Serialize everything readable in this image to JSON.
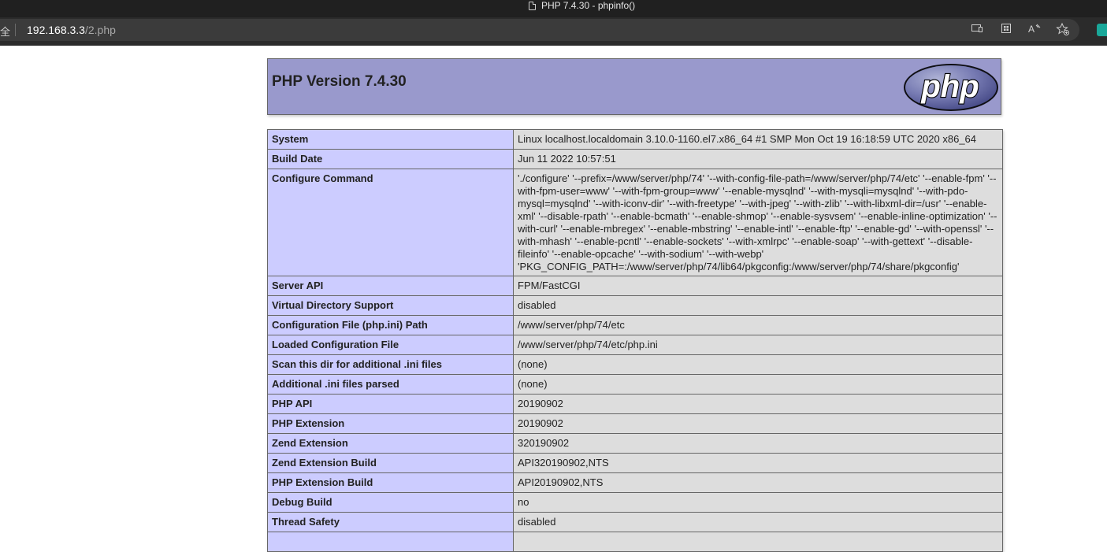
{
  "window": {
    "title": "PHP 7.4.30 - phpinfo()"
  },
  "addressbar": {
    "lock_fragment": "全",
    "url_host": "192.168.3.3",
    "url_path": "/2.php",
    "icons": [
      "immersive-reader-icon",
      "app-available-icon",
      "read-aloud-icon",
      "add-favorite-icon",
      "extension-icon"
    ]
  },
  "page": {
    "heading": "PHP Version 7.4.30",
    "logo_text": "php",
    "colors": {
      "header_bg": "#9999cc",
      "key_cell_bg": "#ccccff",
      "value_cell_bg": "#dddddd"
    },
    "rows": [
      {
        "key": "System",
        "value": "Linux localhost.localdomain 3.10.0-1160.el7.x86_64 #1 SMP Mon Oct 19 16:18:59 UTC 2020 x86_64"
      },
      {
        "key": "Build Date",
        "value": "Jun 11 2022 10:57:51"
      },
      {
        "key": "Configure Command",
        "value": "'./configure' '--prefix=/www/server/php/74' '--with-config-file-path=/www/server/php/74/etc' '--enable-fpm' '--with-fpm-user=www' '--with-fpm-group=www' '--enable-mysqlnd' '--with-mysqli=mysqlnd' '--with-pdo-mysql=mysqlnd' '--with-iconv-dir' '--with-freetype' '--with-jpeg' '--with-zlib' '--with-libxml-dir=/usr' '--enable-xml' '--disable-rpath' '--enable-bcmath' '--enable-shmop' '--enable-sysvsem' '--enable-inline-optimization' '--with-curl' '--enable-mbregex' '--enable-mbstring' '--enable-intl' '--enable-ftp' '--enable-gd' '--with-openssl' '--with-mhash' '--enable-pcntl' '--enable-sockets' '--with-xmlrpc' '--enable-soap' '--with-gettext' '--disable-fileinfo' '--enable-opcache' '--with-sodium' '--with-webp' 'PKG_CONFIG_PATH=:/www/server/php/74/lib64/pkgconfig:/www/server/php/74/share/pkgconfig'"
      },
      {
        "key": "Server API",
        "value": "FPM/FastCGI"
      },
      {
        "key": "Virtual Directory Support",
        "value": "disabled"
      },
      {
        "key": "Configuration File (php.ini) Path",
        "value": "/www/server/php/74/etc"
      },
      {
        "key": "Loaded Configuration File",
        "value": "/www/server/php/74/etc/php.ini"
      },
      {
        "key": "Scan this dir for additional .ini files",
        "value": "(none)"
      },
      {
        "key": "Additional .ini files parsed",
        "value": "(none)"
      },
      {
        "key": "PHP API",
        "value": "20190902"
      },
      {
        "key": "PHP Extension",
        "value": "20190902"
      },
      {
        "key": "Zend Extension",
        "value": "320190902"
      },
      {
        "key": "Zend Extension Build",
        "value": "API320190902,NTS"
      },
      {
        "key": "PHP Extension Build",
        "value": "API20190902,NTS"
      },
      {
        "key": "Debug Build",
        "value": "no"
      },
      {
        "key": "Thread Safety",
        "value": "disabled"
      },
      {
        "key": "",
        "value": ""
      }
    ]
  }
}
